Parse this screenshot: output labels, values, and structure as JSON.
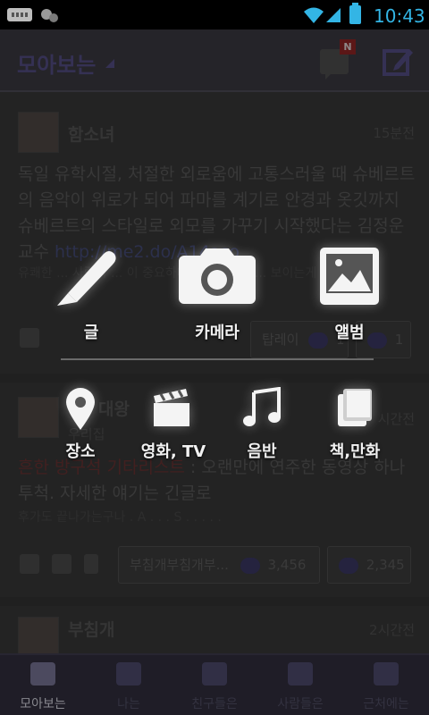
{
  "status_bar": {
    "time": "10:43",
    "icons": [
      "keyboard-icon",
      "talk-icon",
      "wifi-icon",
      "signal-icon",
      "battery-icon"
    ]
  },
  "header": {
    "title": "모아보는",
    "badge": "N",
    "icons": [
      "message-icon",
      "compose-icon"
    ]
  },
  "posts": [
    {
      "name": "함소녀",
      "time": "15분전",
      "body": "독일 유학시절, 처절한 외로움에 고통스러울 때 슈베르트의 음악이 위로가 되어 파마를 계기로 안경과 옷깃까지 슈베르트의 스타일로 외모를 가꾸기 시작했다는 김정운 교수",
      "link": "http://me2.do/A14aso",
      "sub": "유쾌한 ... 사람의 ... 이 중요하다 ... 다. 근데 ... 보이는게 전 ...",
      "chip": "탑레이",
      "likes": "1",
      "comments": "1"
    },
    {
      "name": "대왕",
      "sub_name": "우리집",
      "time": "시간전",
      "body_red": "흔한 방구석 기타리스트",
      "body": " : 오랜만에 연주한 동영상 하나 투척. 자세한 얘기는 긴글로",
      "sub": "후가도 끝나가는구나 . A . . . S . . . . .",
      "chip": "부침개부침개부...",
      "likes": "3,456",
      "comments": "2,345"
    },
    {
      "name": "부침개",
      "time": "2시간전"
    }
  ],
  "menu": {
    "row1": [
      {
        "label": "글",
        "icon": "pencil-icon"
      },
      {
        "label": "카메라",
        "icon": "camera-icon"
      },
      {
        "label": "앨범",
        "icon": "album-icon"
      }
    ],
    "row2": [
      {
        "label": "장소",
        "icon": "location-pin-icon"
      },
      {
        "label": "영화, TV",
        "icon": "clapperboard-icon"
      },
      {
        "label": "음반",
        "icon": "music-note-icon"
      },
      {
        "label": "책,만화",
        "icon": "book-icon"
      }
    ]
  },
  "bottom_nav": [
    {
      "label": "모아보는",
      "icon": "feed-icon",
      "active": true
    },
    {
      "label": "나는",
      "icon": "person-icon"
    },
    {
      "label": "친구들은",
      "icon": "friends-icon"
    },
    {
      "label": "사람들은",
      "icon": "people-icon"
    },
    {
      "label": "근처에는",
      "icon": "nearby-icon"
    }
  ]
}
